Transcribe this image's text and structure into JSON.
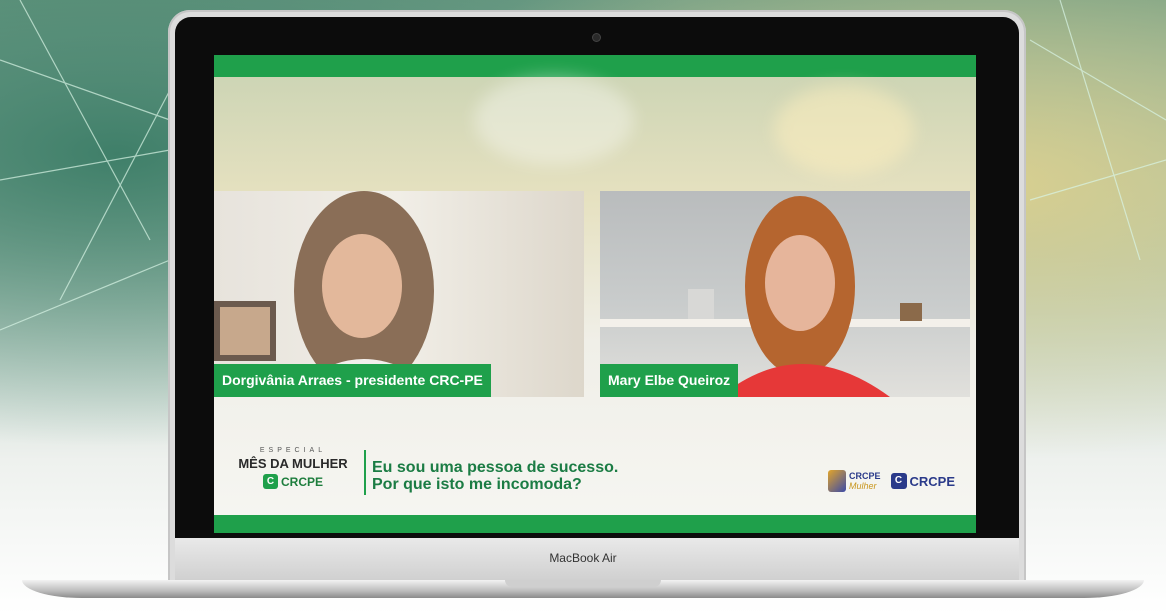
{
  "laptop": {
    "model_label": "MacBook Air"
  },
  "video_call": {
    "participants": [
      {
        "name": "Dorgivânia Arraes - presidente CRC-PE"
      },
      {
        "name": "Mary Elbe Queiroz"
      }
    ]
  },
  "footer": {
    "brand_especial": "ESPECIAL",
    "brand_mes": "MÊS DA MULHER",
    "brand_crc": "CRCPE",
    "headline_line1": "Eu sou uma pessoa de sucesso.",
    "headline_line2": "Por que isto me incomoda?",
    "logo_mulher_title": "CRCPE",
    "logo_mulher_sub": "Mulher",
    "logo_crc": "CRCPE"
  },
  "colors": {
    "accent_green": "#1fa04b",
    "text_green": "#1b7c44",
    "brand_blue": "#2a3a8a",
    "brand_gold": "#c8961e"
  }
}
